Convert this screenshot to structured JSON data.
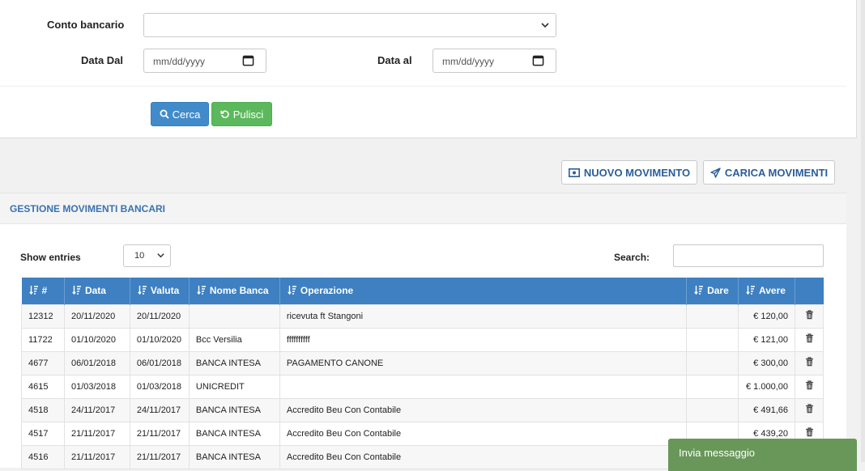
{
  "filters": {
    "conto_label": "Conto bancario",
    "conto_value": "",
    "data_dal_label": "Data Dal",
    "data_dal_placeholder": "mm/dd/yyyy",
    "data_al_label": "Data al",
    "data_al_placeholder": "mm/dd/yyyy",
    "search_button": "Cerca",
    "clear_button": "Pulisci"
  },
  "actions": {
    "new_movement": "NUOVO MOVIMENTO",
    "upload_movements": "CARICA MOVIMENTI"
  },
  "panel": {
    "title": "GESTIONE MOVIMENTI BANCARI",
    "show_entries_label": "Show entries",
    "entries_value": "10",
    "search_label": "Search:",
    "search_value": ""
  },
  "table": {
    "columns": [
      "#",
      "Data",
      "Valuta",
      "Nome Banca",
      "Operazione",
      "Dare",
      "Avere",
      ""
    ],
    "rows": [
      {
        "id": "12312",
        "data": "20/11/2020",
        "valuta": "20/11/2020",
        "banca": "",
        "operazione": "ricevuta ft Stangoni",
        "dare": "",
        "avere": "€ 120,00"
      },
      {
        "id": "11722",
        "data": "01/10/2020",
        "valuta": "01/10/2020",
        "banca": "Bcc Versilia",
        "operazione": "ffffffffff",
        "dare": "",
        "avere": "€ 121,00"
      },
      {
        "id": "4677",
        "data": "06/01/2018",
        "valuta": "06/01/2018",
        "banca": "BANCA INTESA",
        "operazione": "PAGAMENTO CANONE",
        "dare": "",
        "avere": "€ 300,00"
      },
      {
        "id": "4615",
        "data": "01/03/2018",
        "valuta": "01/03/2018",
        "banca": "UNICREDIT",
        "operazione": "",
        "dare": "",
        "avere": "€ 1.000,00"
      },
      {
        "id": "4518",
        "data": "24/11/2017",
        "valuta": "24/11/2017",
        "banca": "BANCA INTESA",
        "operazione": "Accredito Beu Con Contabile",
        "dare": "",
        "avere": "€ 491,66"
      },
      {
        "id": "4517",
        "data": "21/11/2017",
        "valuta": "21/11/2017",
        "banca": "BANCA INTESA",
        "operazione": "Accredito Beu Con Contabile",
        "dare": "",
        "avere": "€ 439,20"
      },
      {
        "id": "4516",
        "data": "21/11/2017",
        "valuta": "21/11/2017",
        "banca": "BANCA INTESA",
        "operazione": "Accredito Beu Con Contabile",
        "dare": "",
        "avere": ""
      }
    ]
  },
  "chat": {
    "label": "Invia messaggio"
  },
  "colors": {
    "primary": "#428bca",
    "success": "#5cb85c",
    "table_header": "#3e80c1",
    "title_blue": "#3a72b0",
    "chat_green": "#69975a"
  },
  "icons": [
    "chevron-down-icon",
    "calendar-icon",
    "search-icon",
    "refresh-icon",
    "money-icon",
    "send-icon",
    "sort-icon",
    "trash-icon"
  ]
}
